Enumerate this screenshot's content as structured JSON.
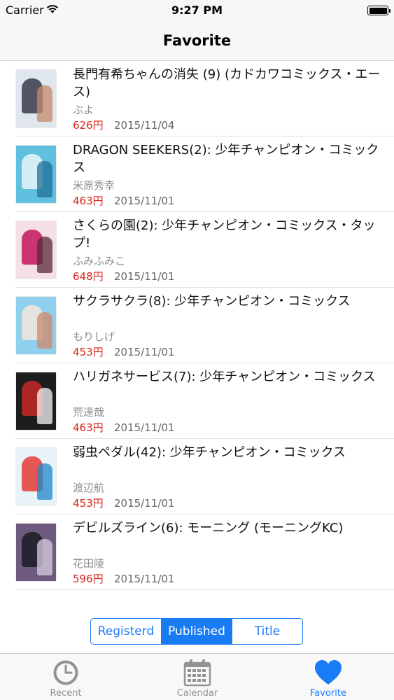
{
  "status_bar": {
    "carrier": "Carrier",
    "time": "9:27 PM"
  },
  "nav": {
    "title": "Favorite"
  },
  "items": [
    {
      "title": "長門有希ちゃんの消失 (9) (カドカワコミックス・エース)",
      "author": "ぶよ",
      "price": "626円",
      "date": "2015/11/04",
      "colors": [
        "#dfe6ee",
        "#3b3a4a",
        "#c58a6a"
      ]
    },
    {
      "title": "DRAGON SEEKERS(2): 少年チャンピオン・コミックス",
      "author": "米原秀幸",
      "price": "463円",
      "date": "2015/11/01",
      "colors": [
        "#5fc0e0",
        "#e9f6fb",
        "#1f6f96"
      ]
    },
    {
      "title": "さくらの園(2): 少年チャンピオン・コミックス・タップ!",
      "author": "ふみふみこ",
      "price": "648円",
      "date": "2015/11/01",
      "colors": [
        "#f4dfe6",
        "#c2185b",
        "#5a2a3a"
      ]
    },
    {
      "title": "サクラサクラ(8): 少年チャンピオン・コミックス",
      "author": "もりしげ",
      "price": "453円",
      "date": "2015/11/01",
      "colors": [
        "#8fd0ef",
        "#f2e8dc",
        "#d08a6a"
      ]
    },
    {
      "title": "ハリガネサービス(7): 少年チャンピオン・コミックス",
      "author": "荒達哉",
      "price": "463円",
      "date": "2015/11/01",
      "colors": [
        "#1d1d1d",
        "#c62828",
        "#f5f5f5"
      ]
    },
    {
      "title": "弱虫ペダル(42): 少年チャンピオン・コミックス",
      "author": "渡辺航",
      "price": "453円",
      "date": "2015/11/01",
      "colors": [
        "#e8f3f7",
        "#e53935",
        "#1e88c8"
      ]
    },
    {
      "title": "デビルズライン(6): モーニング (モーニングKC)",
      "author": "花田陵",
      "price": "596円",
      "date": "2015/11/01",
      "colors": [
        "#6d5a7e",
        "#1c1c24",
        "#d8cfe0"
      ]
    }
  ],
  "segments": [
    "Registerd",
    "Published",
    "Title"
  ],
  "selected_segment": "Published",
  "tabs": [
    {
      "label": "Recent",
      "icon": "clock-icon"
    },
    {
      "label": "Calendar",
      "icon": "calendar-icon"
    },
    {
      "label": "Favorite",
      "icon": "heart-icon"
    }
  ],
  "selected_tab": "Favorite",
  "colors": {
    "accent": "#1a7cf4",
    "price": "#d9251d"
  }
}
